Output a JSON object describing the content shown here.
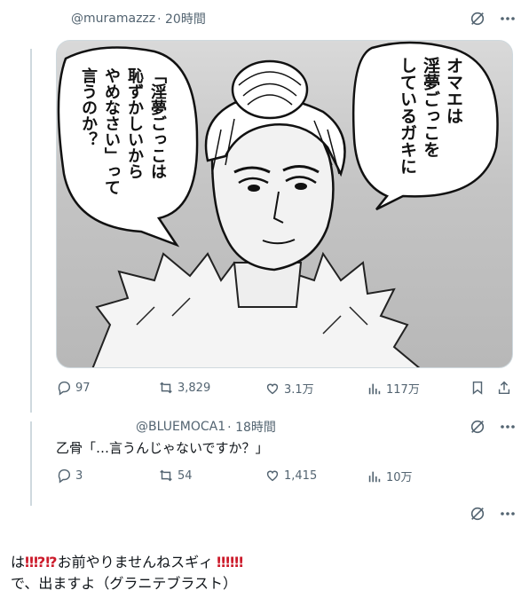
{
  "tweet1": {
    "handle": "@muramazzz",
    "time": "· 20時間",
    "manga": {
      "bubble_right": [
        "オマエは",
        "淫夢ごっこを",
        "しているガキに"
      ],
      "bubble_left": [
        "「淫夢ごっこは",
        "恥ずかしいから",
        "やめなさい」って",
        "言うのか？"
      ]
    },
    "stats": {
      "replies": "97",
      "retweets": "3,829",
      "likes": "3.1万",
      "views": "117万"
    }
  },
  "tweet2": {
    "handle": "@BLUEMOCA1",
    "time": "· 18時間",
    "text": "乙骨「…言うんじゃないですか？」",
    "stats": {
      "replies": "3",
      "retweets": "54",
      "likes": "1,415",
      "views": "10万"
    }
  },
  "post": {
    "prefix": "は",
    "marks1": "‼⁉⁉",
    "middle": "お前やりませんねスギィ",
    "marks2": "‼‼‼",
    "line2": "で、出ますよ（グラニテブラスト）"
  },
  "colors": {
    "text": "#0f1419",
    "muted": "#536471",
    "border": "#cfd9de",
    "red": "#cc1b2b"
  }
}
